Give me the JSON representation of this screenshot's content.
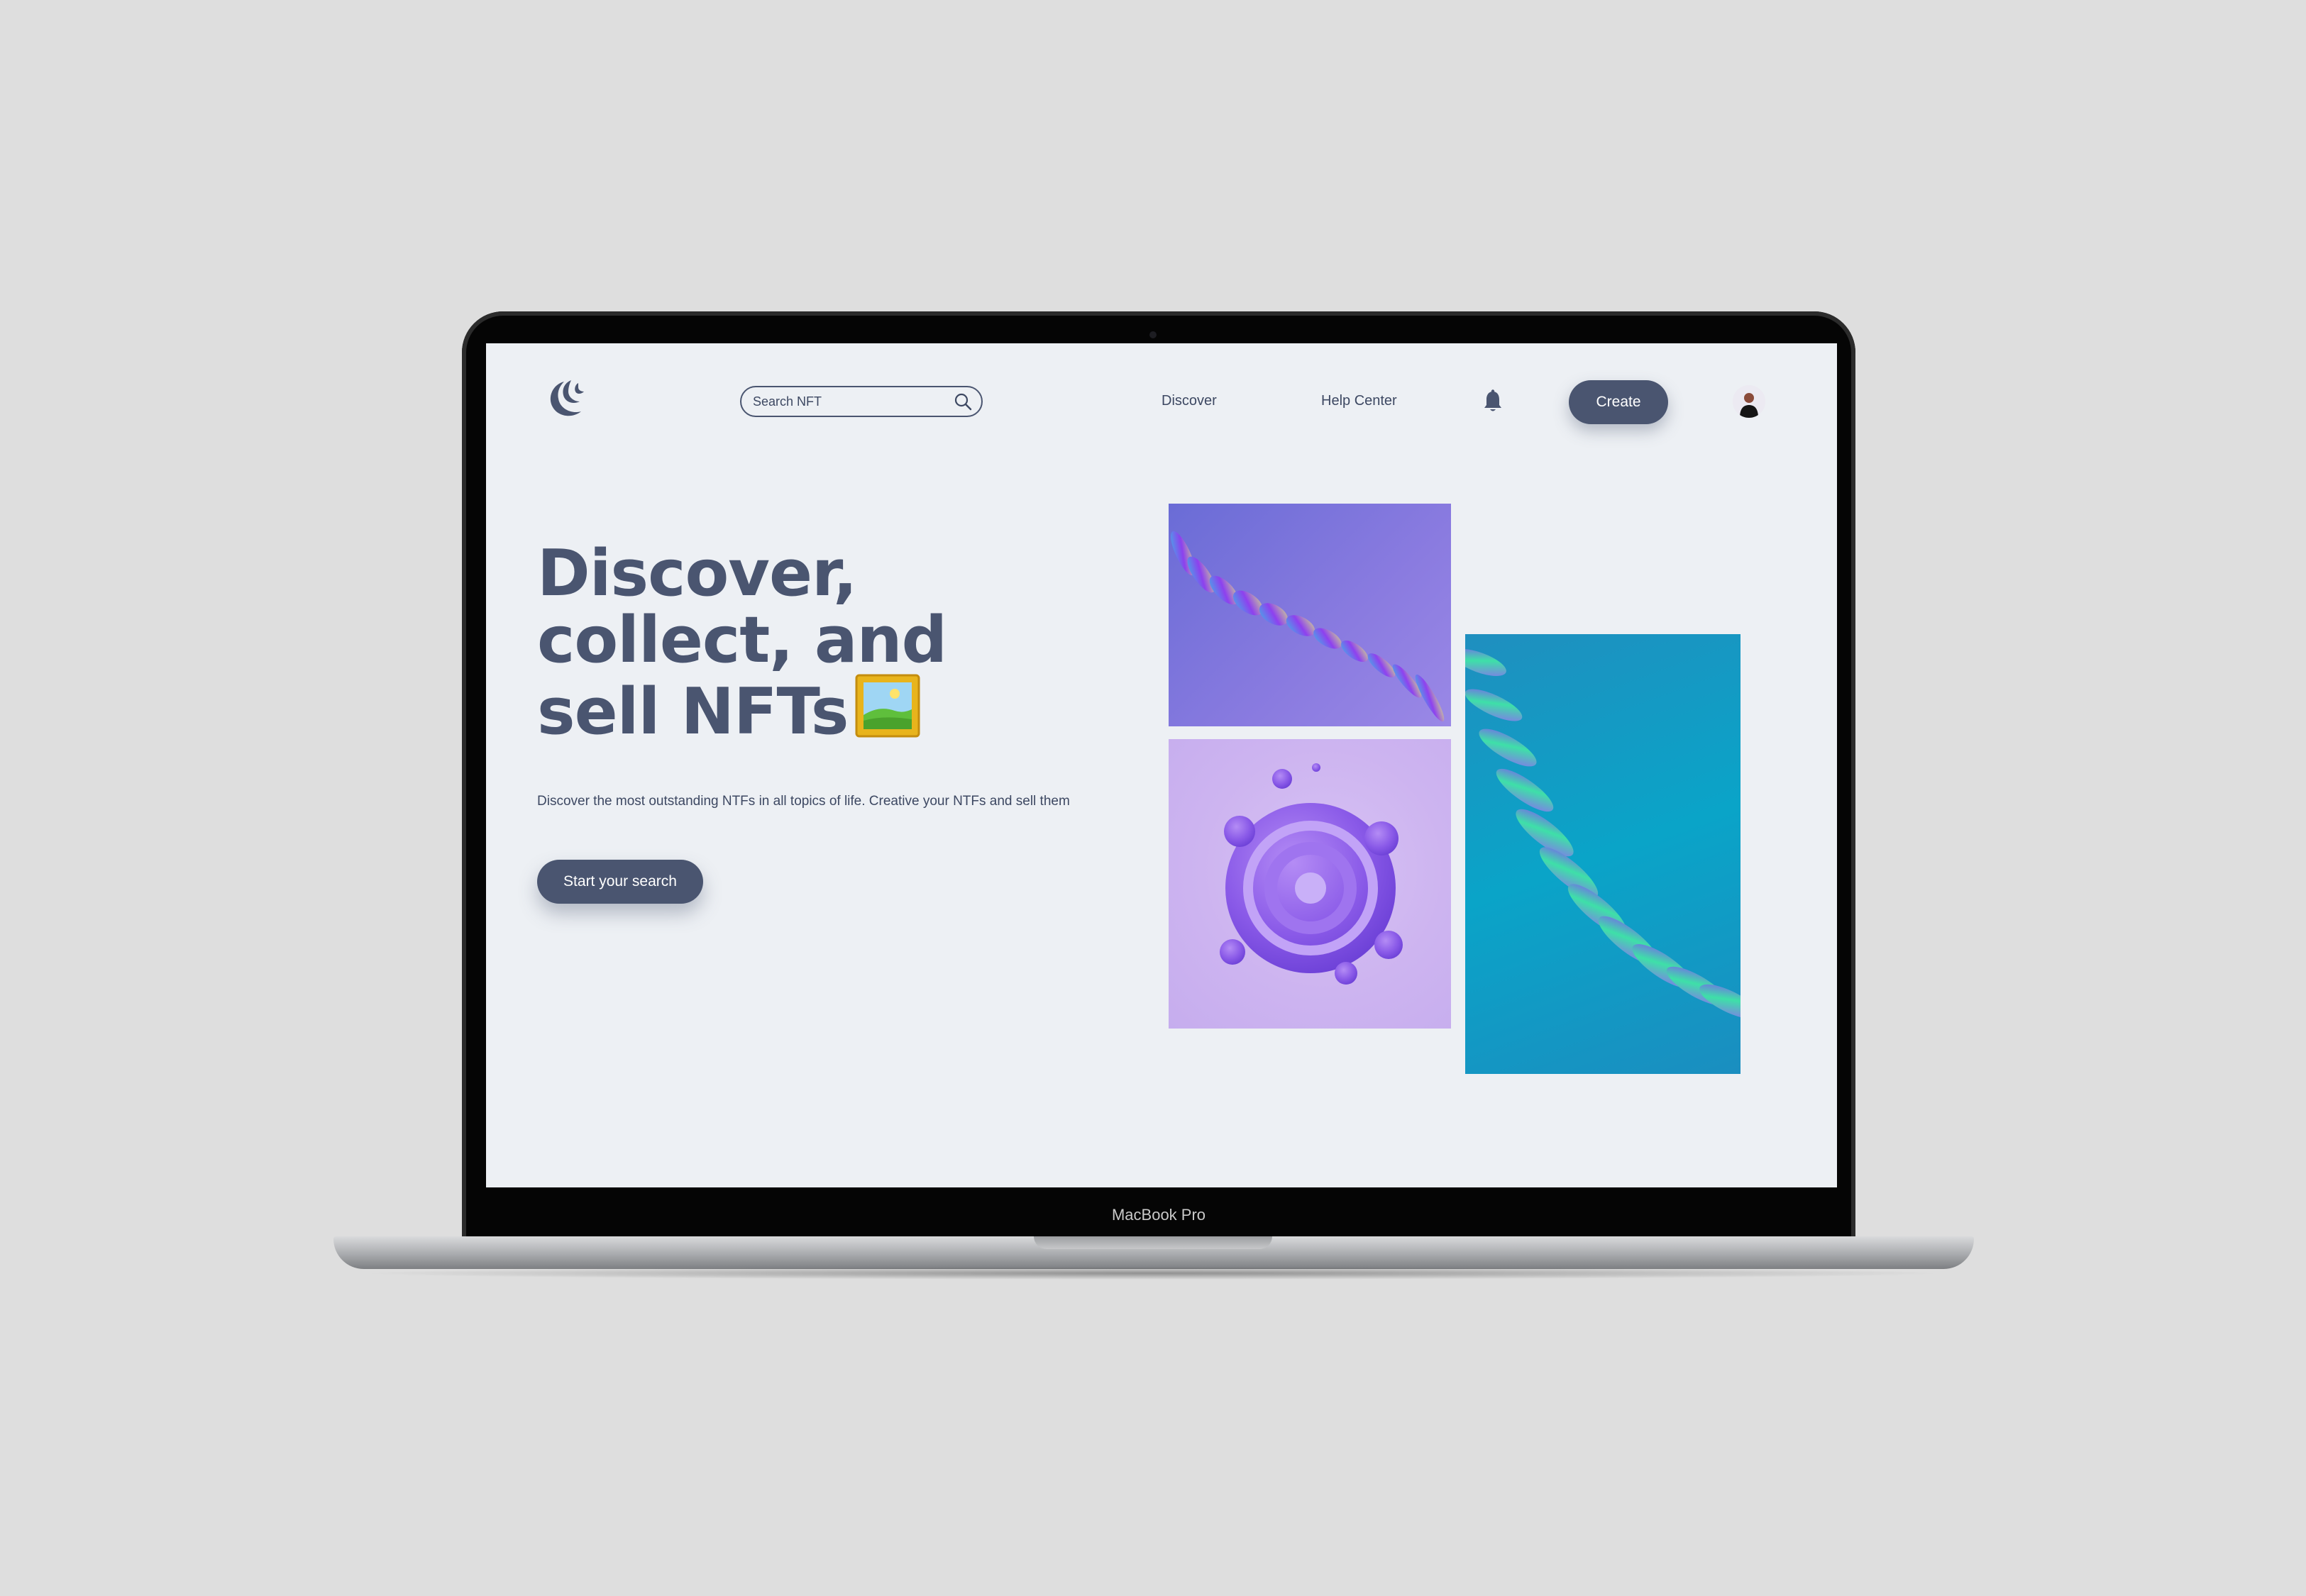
{
  "device": {
    "label": "MacBook Pro"
  },
  "header": {
    "search_placeholder": "Search NFT",
    "nav": [
      "Discover",
      "Help Center"
    ],
    "create_label": "Create"
  },
  "hero": {
    "title_lines": [
      "Discover,",
      "collect, and",
      "sell NFTs"
    ],
    "subtitle": "Discover the most outstanding NTFs in all topics of life. Creative your NTFs and sell them",
    "cta_label": "Start your search"
  },
  "icons": {
    "logo": "crescent-logo-icon",
    "search": "search-icon",
    "notification": "bell-icon",
    "title_emoji": "framed-picture-icon"
  },
  "colors": {
    "primary": "#4a5570",
    "background": "#edf0f4",
    "text": "#3d4862"
  }
}
